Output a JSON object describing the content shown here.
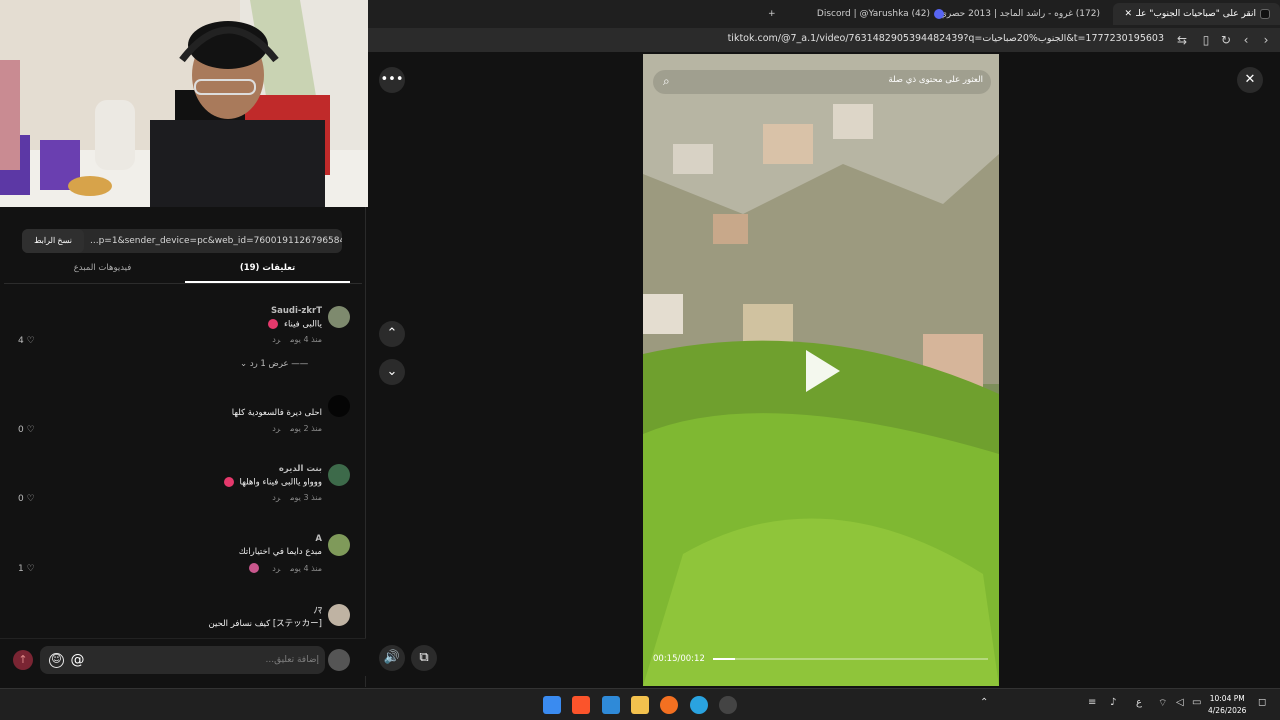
{
  "browser": {
    "tabs": [
      {
        "title": "انقر علی \"صباحيات الجنوب\" علـ",
        "active": true
      },
      {
        "title": "(172) غروه - راشد الماجد | 2013 حصري",
        "active": false
      },
      {
        "title": "(42) Discord | @Yarushka",
        "active": false
      }
    ],
    "new_tab": "+",
    "url": "tiktok.com/@7_a.1/video/7631482905394482439?q=الجنوب%20صباحيات&t=1777230195603",
    "close_tab": "✕"
  },
  "panel": {
    "share_url": "...p=1&sender_device=pc&web_id=7600191126796584464",
    "copy_link": "نسخ الرابط",
    "tabs": [
      {
        "label": "(19) تعليقات",
        "active": true
      },
      {
        "label": "فيديوهات المبدع",
        "active": false
      }
    ],
    "comments": [
      {
        "user": "Saudi-zkrT",
        "text": "ياالبی فیناء",
        "time": "منذ 4 يوم",
        "reply": "رد",
        "likes": "4"
      },
      {
        "user": "",
        "text": "احلى ديرة فالسعودية كلها",
        "time": "منذ 2 يوم",
        "reply": "رد",
        "likes": "0"
      },
      {
        "user": "بنت الديره",
        "text": "ووواو ياالبی فیناء واهلها",
        "time": "منذ 3 يوم",
        "reply": "رد",
        "likes": "0"
      },
      {
        "user": "A",
        "text": "مبدع دايما في اختياراتك",
        "time": "منذ 4 يوم",
        "reply": "رد",
        "likes": "1"
      },
      {
        "user": "ﾉﾏ",
        "text": "[ステッカー] كيف نسافر الحين",
        "time": "",
        "reply": "",
        "likes": ""
      }
    ],
    "view_replies": "عرض 1 رد",
    "input_placeholder": "إضافة تعليق..."
  },
  "viewer": {
    "search_placeholder": "العثور على محتوى ذي صلة",
    "time": "00:15/00:12",
    "progress": 0.08
  },
  "taskbar": {
    "time": "10:04 PM",
    "date": "4/26/2026",
    "lang": "ع"
  }
}
